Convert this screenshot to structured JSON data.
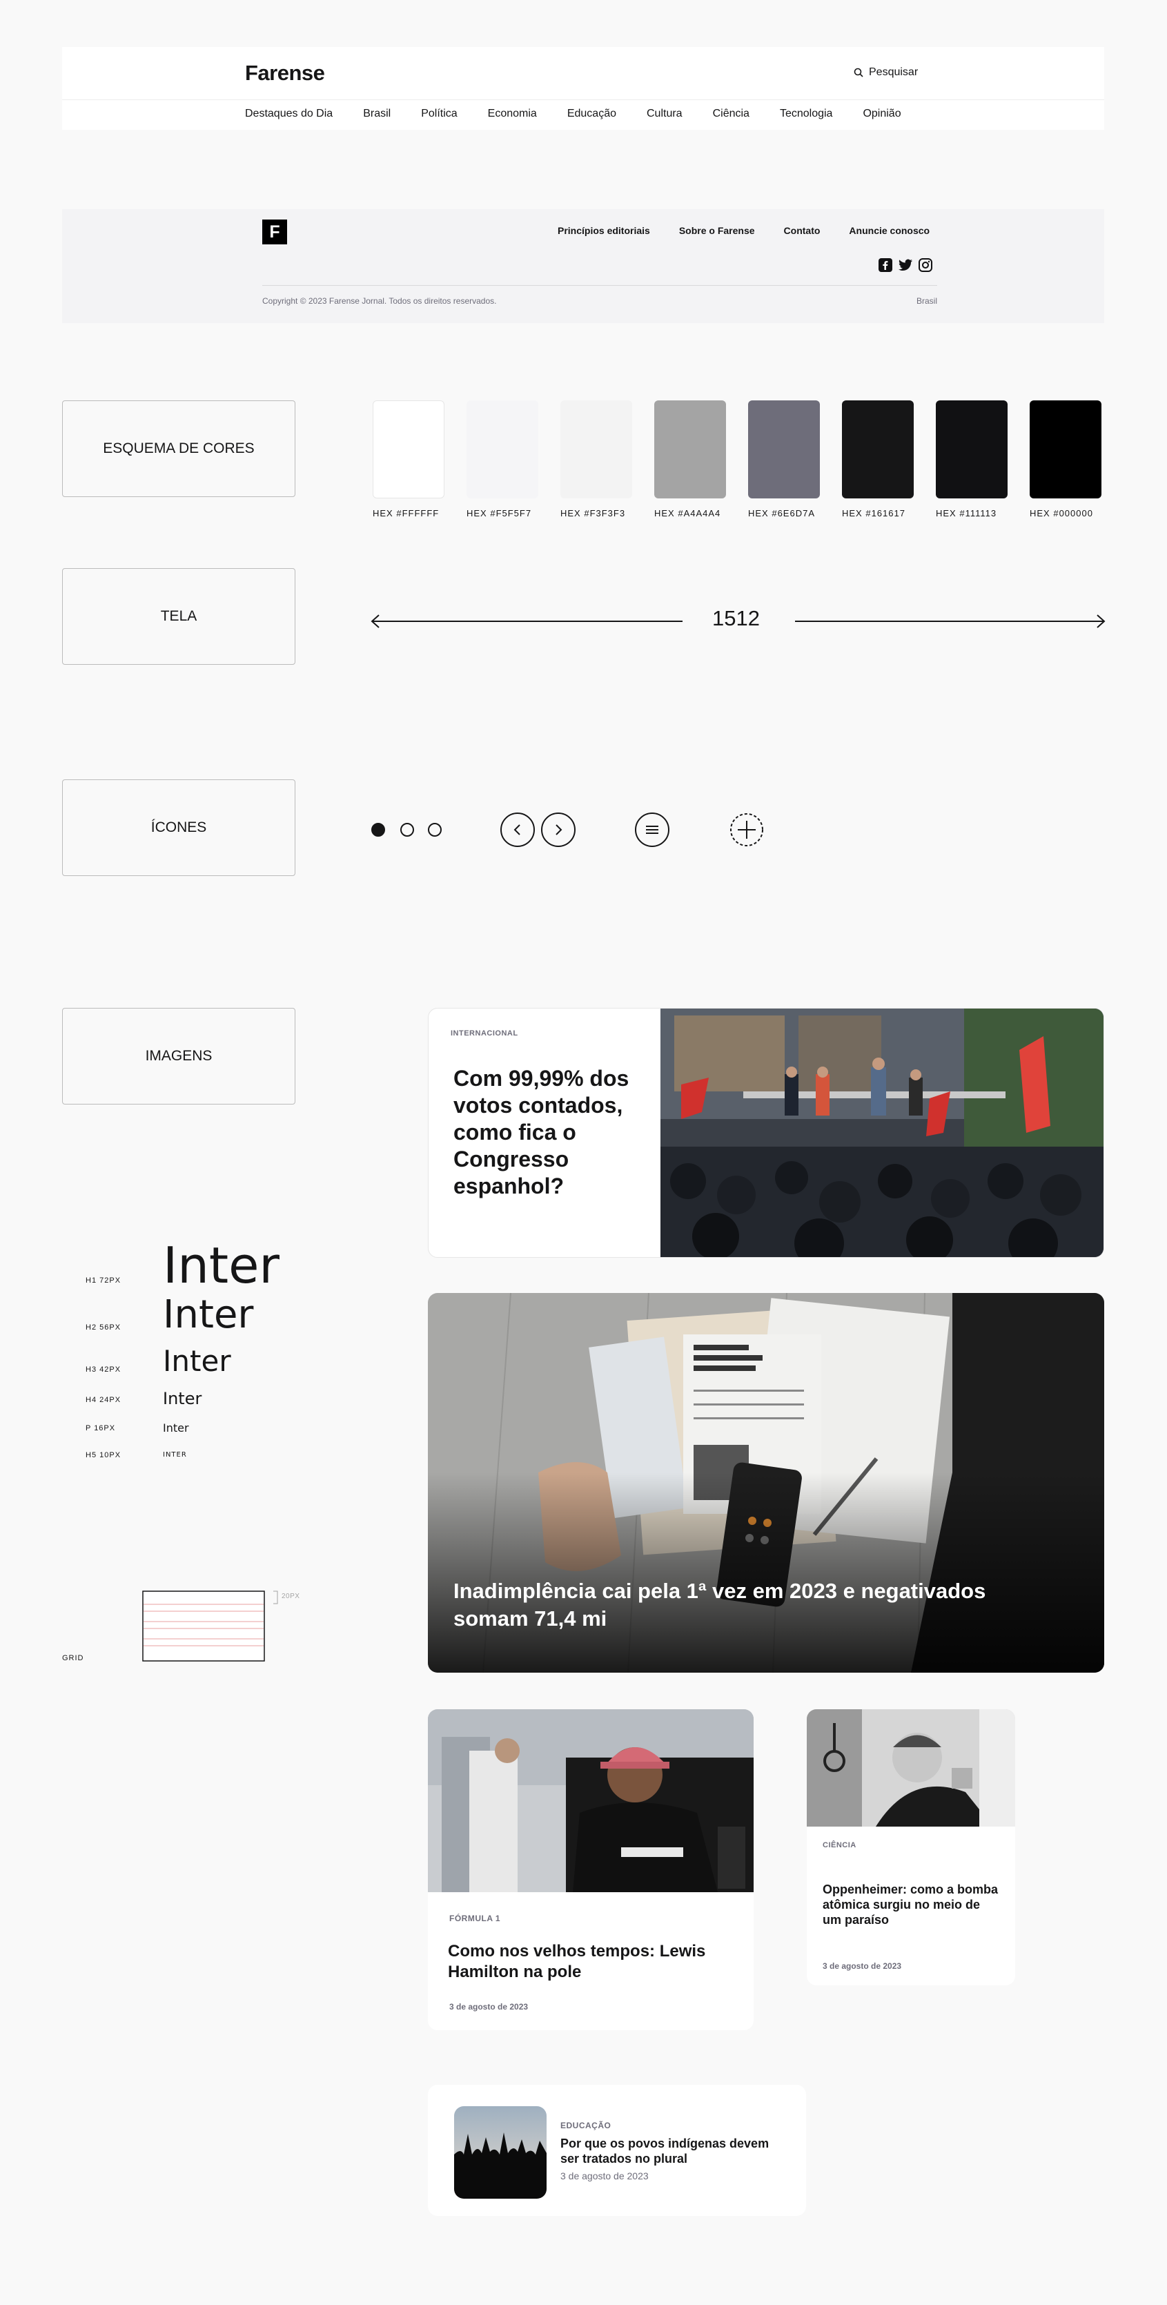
{
  "header": {
    "brand": "Farense",
    "search_label": "Pesquisar",
    "nav": [
      "Destaques do Dia",
      "Brasil",
      "Política",
      "Economia",
      "Educação",
      "Cultura",
      "Ciência",
      "Tecnologia",
      "Opinião"
    ]
  },
  "footer": {
    "logo_letter": "F",
    "links": [
      "Princípios editoriais",
      "Sobre o Farense",
      "Contato",
      "Anuncie conosco"
    ],
    "socials": [
      "facebook-icon",
      "twitter-icon",
      "instagram-icon"
    ],
    "copyright": "Copyright © 2023 Farense Jornal. Todos os direitos reservados.",
    "region": "Brasil"
  },
  "sections": {
    "colors": "ESQUEMA DE CORES",
    "screen": "TELA",
    "icons": "ÍCONES",
    "images": "IMAGENS"
  },
  "palette": [
    {
      "code": "HEX  #FFFFFF",
      "hex": "#FFFFFF"
    },
    {
      "code": "HEX  #F5F5F7",
      "hex": "#F5F5F7"
    },
    {
      "code": "HEX  #F3F3F3",
      "hex": "#F3F3F3"
    },
    {
      "code": "HEX  #A4A4A4",
      "hex": "#A4A4A4"
    },
    {
      "code": "HEX  #6E6D7A",
      "hex": "#6E6D7A"
    },
    {
      "code": "HEX  #161617",
      "hex": "#161617"
    },
    {
      "code": "HEX  #111113",
      "hex": "#111113"
    },
    {
      "code": "HEX  #000000",
      "hex": "#000000"
    }
  ],
  "screen": {
    "width": "1512"
  },
  "icons": [
    "dot-filled-icon",
    "dot-empty-icon",
    "dot-empty-icon",
    "chevron-left-icon",
    "chevron-right-icon",
    "menu-icon",
    "plus-icon"
  ],
  "typography": [
    {
      "label": "H1 72PX",
      "sample": "Inter"
    },
    {
      "label": "H2 56PX",
      "sample": "Inter"
    },
    {
      "label": "H3 42PX",
      "sample": "Inter"
    },
    {
      "label": "H4 24PX",
      "sample": "Inter"
    },
    {
      "label": "P 16PX",
      "sample": "Inter"
    },
    {
      "label": "H5 10PX",
      "sample": "INTER"
    }
  ],
  "grid": {
    "label": "GRID",
    "gutter": "20PX"
  },
  "articles": {
    "feature": {
      "kicker": "INTERNACIONAL",
      "title": "Com 99,99% dos votos contados, como fica o Congresso espanhol?"
    },
    "hero": {
      "title": "Inadimplência cai pela 1ª vez em 2023 e negativados somam 71,4 mi"
    },
    "f1": {
      "kicker": "FÓRMULA 1",
      "title": "Como nos velhos tempos: Lewis Hamilton na pole",
      "date": "3 de agosto de 2023"
    },
    "science": {
      "kicker": "CIÊNCIA",
      "title": "Oppenheimer: como a bomba atômica surgiu no meio de um paraíso",
      "date": "3 de agosto de 2023"
    },
    "education": {
      "kicker": "EDUCAÇÃO",
      "title": "Por que os povos indígenas devem ser tratados no plural",
      "date": "3 de agosto de 2023"
    }
  }
}
